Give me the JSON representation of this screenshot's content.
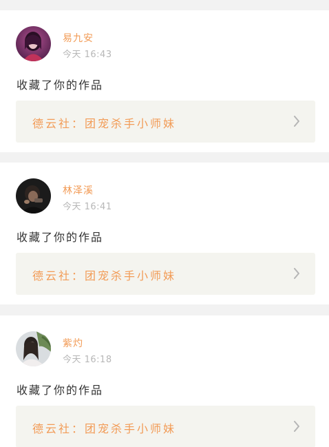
{
  "feed": {
    "items": [
      {
        "user": "易九安",
        "time": "今天 16:43",
        "action": "收藏了你的作品",
        "work": "德云社：团宠杀手小师妹",
        "avatar": "avatar-photo-purple-hair-girl"
      },
      {
        "user": "林泽溪",
        "time": "今天 16:41",
        "action": "收藏了你的作品",
        "work": "德云社：团宠杀手小师妹",
        "avatar": "avatar-photo-dark-boy"
      },
      {
        "user": "紫灼",
        "time": "今天 16:18",
        "action": "收藏了你的作品",
        "work": "德云社：团宠杀手小师妹",
        "avatar": "avatar-photo-girl-with-plant"
      }
    ]
  },
  "colors": {
    "accent": "#f29b56",
    "time": "#b7b7b7",
    "text": "#333333",
    "card": "#ffffff",
    "divider": "#f2f2f2",
    "work_bg": "#f4f4ef"
  }
}
